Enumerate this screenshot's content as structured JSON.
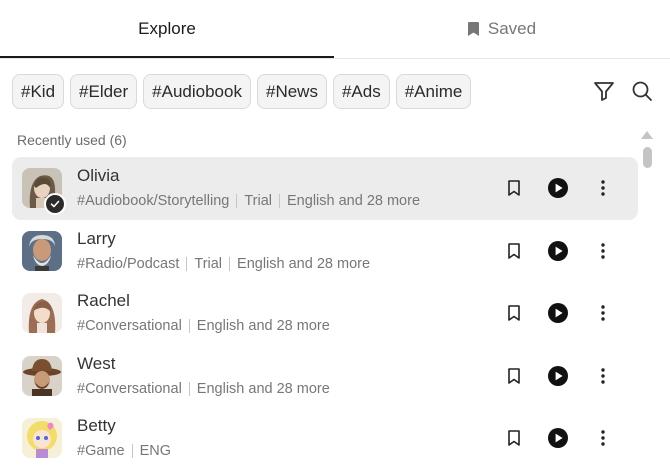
{
  "tabs": {
    "explore": "Explore",
    "saved": "Saved"
  },
  "chips": [
    "#Kid",
    "#Elder",
    "#Audiobook",
    "#News",
    "#Ads",
    "#Anime"
  ],
  "section_label": "Recently used (6)",
  "voices": [
    {
      "name": "Olivia",
      "tags": [
        "#Audiobook/Storytelling",
        "Trial",
        "English and 28 more"
      ]
    },
    {
      "name": "Larry",
      "tags": [
        "#Radio/Podcast",
        "Trial",
        "English and 28 more"
      ]
    },
    {
      "name": "Rachel",
      "tags": [
        "#Conversational",
        "English and 28 more"
      ]
    },
    {
      "name": "West",
      "tags": [
        "#Conversational",
        "English and 28 more"
      ]
    },
    {
      "name": "Betty",
      "tags": [
        "#Game",
        "ENG"
      ]
    }
  ],
  "icons": {
    "saved_tab": "bookmark-icon",
    "filter": "filter-icon",
    "search": "search-icon",
    "row_actions": [
      "bookmark-icon",
      "play-icon",
      "more-vertical-icon"
    ],
    "selected": "check-icon"
  },
  "colors": {
    "selected_row": "#ececec",
    "chip_bg": "#f4f4f4",
    "active_tab": "#1a1a1a"
  }
}
